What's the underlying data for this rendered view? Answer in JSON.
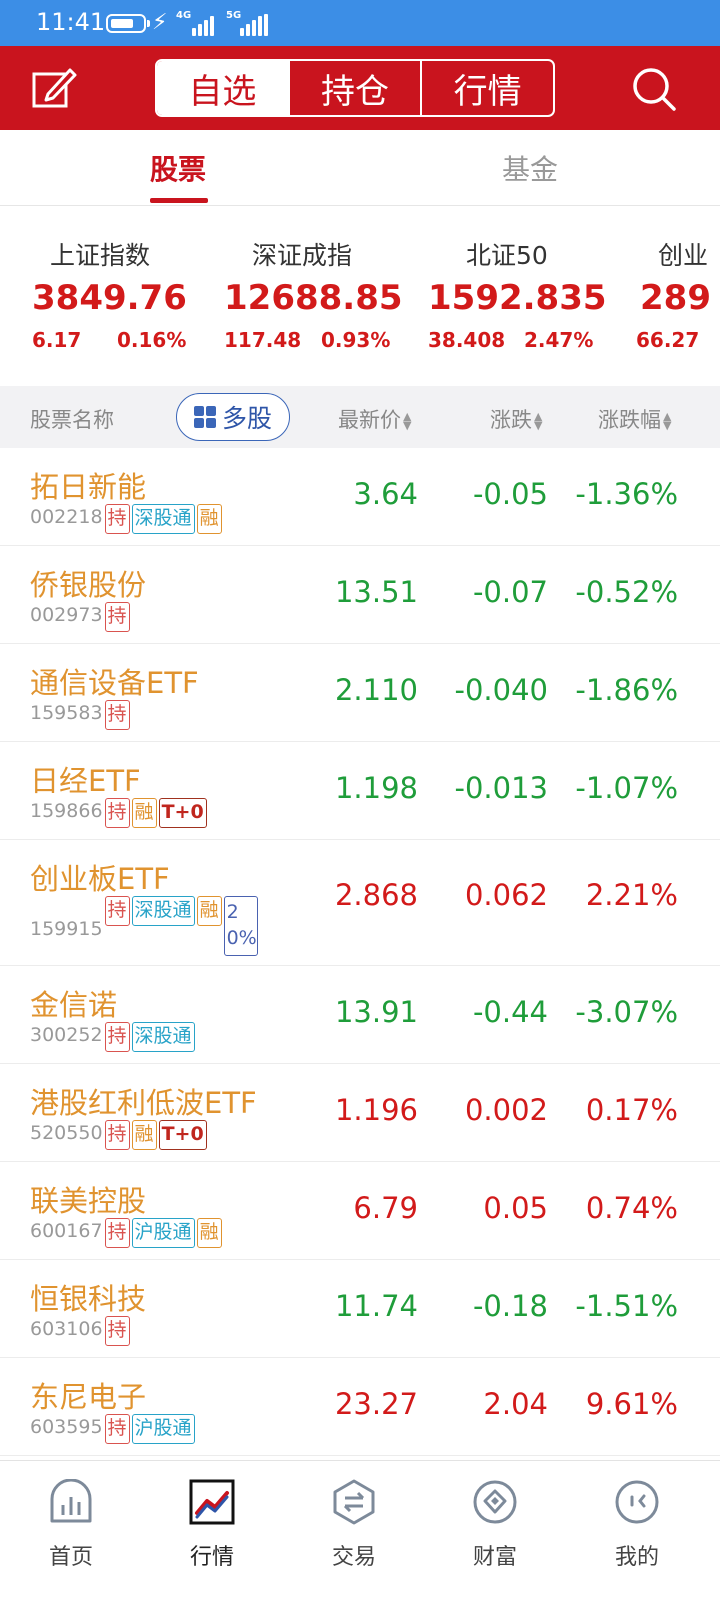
{
  "status_bar": {
    "time": "11:41",
    "net1": "4G",
    "net2": "5G"
  },
  "header": {
    "segments": [
      {
        "label": "自选",
        "active": true
      },
      {
        "label": "持仓",
        "active": false
      },
      {
        "label": "行情",
        "active": false
      }
    ],
    "left_icon": "edit-icon",
    "right_icon": "search-icon"
  },
  "subtabs": [
    {
      "label": "股票",
      "active": true
    },
    {
      "label": "基金",
      "active": false
    }
  ],
  "indices": [
    {
      "name": "上证指数",
      "value": "3849.76",
      "change": "6.17",
      "pct": "0.16%"
    },
    {
      "name": "深证成指",
      "value": "12688.85",
      "change": "117.48",
      "pct": "0.93%"
    },
    {
      "name": "北证50",
      "value": "1592.835",
      "change": "38.408",
      "pct": "2.47%"
    },
    {
      "name": "创业",
      "value": "289",
      "change": "66.27",
      "pct": ""
    }
  ],
  "list_header": {
    "name_col": "股票名称",
    "multi_label": "多股",
    "price_col": "最新价",
    "change_col": "涨跌",
    "pct_col": "涨跌幅"
  },
  "stocks": [
    {
      "name": "拓日新能",
      "code": "002218",
      "tags": [
        "持",
        "深股通",
        "融"
      ],
      "price": "3.64",
      "change": "-0.05",
      "pct": "-1.36%",
      "dir": "down"
    },
    {
      "name": "侨银股份",
      "code": "002973",
      "tags": [
        "持"
      ],
      "price": "13.51",
      "change": "-0.07",
      "pct": "-0.52%",
      "dir": "down"
    },
    {
      "name": "通信设备ETF",
      "code": "159583",
      "tags": [
        "持"
      ],
      "price": "2.110",
      "change": "-0.040",
      "pct": "-1.86%",
      "dir": "down"
    },
    {
      "name": "日经ETF",
      "code": "159866",
      "tags": [
        "持",
        "融",
        "T+0"
      ],
      "price": "1.198",
      "change": "-0.013",
      "pct": "-1.07%",
      "dir": "down"
    },
    {
      "name": "创业板ETF",
      "code": "159915",
      "tags": [
        "持",
        "深股通",
        "融",
        "20%"
      ],
      "price": "2.868",
      "change": "0.062",
      "pct": "2.21%",
      "dir": "up"
    },
    {
      "name": "金信诺",
      "code": "300252",
      "tags": [
        "持",
        "深股通"
      ],
      "price": "13.91",
      "change": "-0.44",
      "pct": "-3.07%",
      "dir": "down"
    },
    {
      "name": "港股红利低波ETF",
      "code": "520550",
      "tags": [
        "持",
        "融",
        "T+0"
      ],
      "price": "1.196",
      "change": "0.002",
      "pct": "0.17%",
      "dir": "up"
    },
    {
      "name": "联美控股",
      "code": "600167",
      "tags": [
        "持",
        "沪股通",
        "融"
      ],
      "price": "6.79",
      "change": "0.05",
      "pct": "0.74%",
      "dir": "up"
    },
    {
      "name": "恒银科技",
      "code": "603106",
      "tags": [
        "持"
      ],
      "price": "11.74",
      "change": "-0.18",
      "pct": "-1.51%",
      "dir": "down"
    },
    {
      "name": "东尼电子",
      "code": "603595",
      "tags": [
        "持",
        "沪股通"
      ],
      "price": "23.27",
      "change": "2.04",
      "pct": "9.61%",
      "dir": "up"
    }
  ],
  "bottom_nav": [
    {
      "label": "首页",
      "icon": "home-chart-icon",
      "active": false
    },
    {
      "label": "行情",
      "icon": "market-trend-icon",
      "active": true
    },
    {
      "label": "交易",
      "icon": "trade-exchange-icon",
      "active": false
    },
    {
      "label": "财富",
      "icon": "wealth-diamond-icon",
      "active": false
    },
    {
      "label": "我的",
      "icon": "profile-face-icon",
      "active": false
    }
  ],
  "colors": {
    "brand_red": "#c9141e",
    "status_blue": "#3c8ee6",
    "up": "#d21a1a",
    "down": "#1f9d3a",
    "stock_name": "#e0932f"
  }
}
